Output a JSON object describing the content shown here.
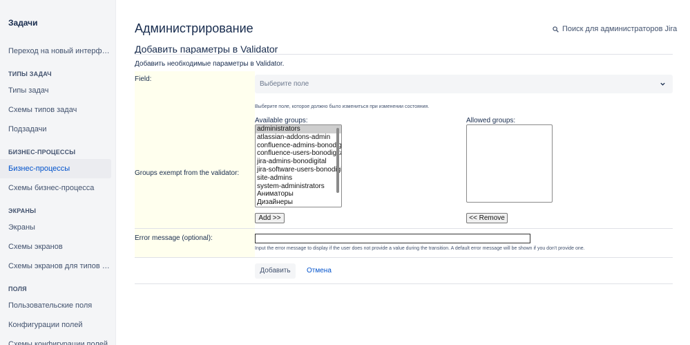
{
  "sidebar": {
    "title": "Задачи",
    "items": [
      {
        "label": "Переход на новый интерфейс"
      },
      {
        "label": "Типы задач"
      },
      {
        "label": "Схемы типов задач"
      },
      {
        "label": "Подзадачи"
      },
      {
        "label": "Бизнес-процессы"
      },
      {
        "label": "Схемы бизнес-процесса"
      },
      {
        "label": "Экраны"
      },
      {
        "label": "Схемы экранов"
      },
      {
        "label": "Схемы экранов для типов задач"
      },
      {
        "label": "Пользовательские поля"
      },
      {
        "label": "Конфигурации полей"
      },
      {
        "label": "Схемы конфигурации полей"
      }
    ],
    "sections": [
      {
        "label": "ТИПЫ ЗАДАЧ"
      },
      {
        "label": "БИЗНЕС-ПРОЦЕССЫ"
      },
      {
        "label": "ЭКРАНЫ"
      },
      {
        "label": "ПОЛЯ"
      }
    ],
    "active_item": "Бизнес-процессы"
  },
  "header": {
    "title": "Администрирование",
    "search_label": "Поиск для администраторов Jira",
    "search_icon": "search-icon"
  },
  "form": {
    "title": "Добавить параметры в Validator",
    "description": "Добавить необходимые параметры в Validator.",
    "field_label": "Field:",
    "field_placeholder": "Выберите поле",
    "field_help": "Выберите поле, которое должно было измениться при изменении состояния.",
    "groups_label": "Groups exempt from the validator:",
    "available_groups_label": "Available groups:",
    "allowed_groups_label": "Allowed groups:",
    "available_groups": [
      "administrators",
      "atlassian-addons-admin",
      "confluence-admins-bonodigital",
      "confluence-users-bonodigital",
      "jira-admins-bonodigital",
      "jira-software-users-bonodigital",
      "site-admins",
      "system-administrators",
      "Аниматоры",
      "Дизайнеры"
    ],
    "selected_available_group": "administrators",
    "allowed_groups": [],
    "add_button": "Add >>",
    "remove_button": "<< Remove",
    "error_label": "Error message (optional):",
    "error_value": "",
    "error_help": "Input the error message to display if the user does not provide a value during the transition. A default error message will be shown if you don't provide one.",
    "submit_button": "Добавить",
    "cancel_link": "Отмена"
  },
  "colors": {
    "label_column_bg": "#ffffee",
    "link": "#0052cc",
    "sidebar_bg": "#f4f5f7"
  }
}
